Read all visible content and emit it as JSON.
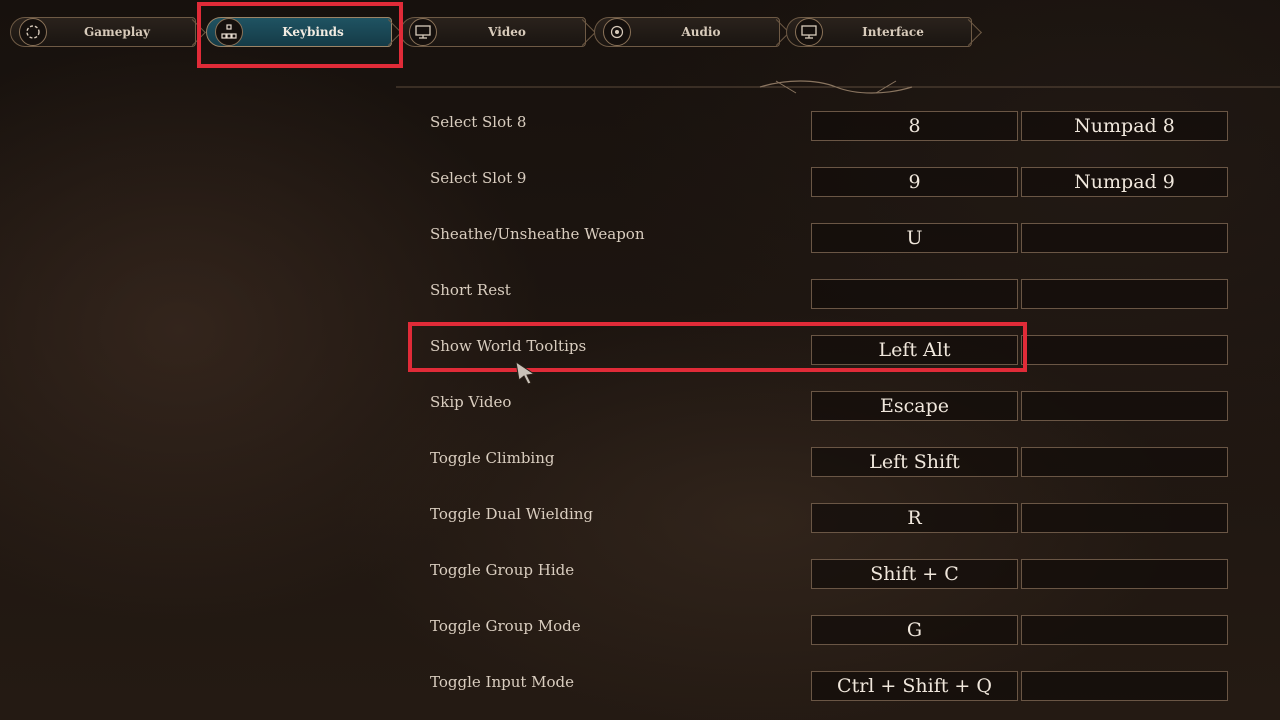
{
  "tabs": [
    {
      "label": "Gameplay",
      "icon": "gameplay-gear-icon",
      "active": false
    },
    {
      "label": "Keybinds",
      "icon": "keybinds-icon",
      "active": true
    },
    {
      "label": "Video",
      "icon": "monitor-icon",
      "active": false
    },
    {
      "label": "Audio",
      "icon": "speaker-icon",
      "active": false
    },
    {
      "label": "Interface",
      "icon": "monitor-icon",
      "active": false
    }
  ],
  "keybinds": [
    {
      "action": "Select Slot 8",
      "primary": "8",
      "secondary": "Numpad 8"
    },
    {
      "action": "Select Slot 9",
      "primary": "9",
      "secondary": "Numpad 9"
    },
    {
      "action": "Sheathe/Unsheathe Weapon",
      "primary": "U",
      "secondary": ""
    },
    {
      "action": "Short Rest",
      "primary": "",
      "secondary": ""
    },
    {
      "action": "Show World Tooltips",
      "primary": "Left Alt",
      "secondary": ""
    },
    {
      "action": "Skip Video",
      "primary": "Escape",
      "secondary": ""
    },
    {
      "action": "Toggle Climbing",
      "primary": "Left Shift",
      "secondary": ""
    },
    {
      "action": "Toggle Dual Wielding",
      "primary": "R",
      "secondary": ""
    },
    {
      "action": "Toggle Group Hide",
      "primary": "Shift + C",
      "secondary": ""
    },
    {
      "action": "Toggle Group Mode",
      "primary": "G",
      "secondary": ""
    },
    {
      "action": "Toggle Input Mode",
      "primary": "Ctrl + Shift + Q",
      "secondary": ""
    }
  ],
  "colors": {
    "accent_teal": "#1f5362",
    "highlight_red": "#e02b38",
    "border_bronze": "#6e5a45"
  }
}
